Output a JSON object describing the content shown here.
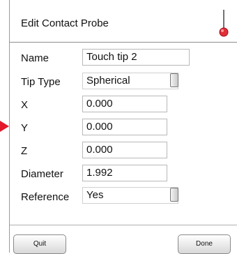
{
  "dialog": {
    "title": "Edit Contact Probe",
    "icon": "probe-tip-icon"
  },
  "fields": {
    "name": {
      "label": "Name",
      "value": "Touch tip 2"
    },
    "tip_type": {
      "label": "Tip Type",
      "value": "Spherical"
    },
    "x": {
      "label": "X",
      "value": "0.000"
    },
    "y": {
      "label": "Y",
      "value": "0.000"
    },
    "z": {
      "label": "Z",
      "value": "0.000"
    },
    "diameter": {
      "label": "Diameter",
      "value": "1.992"
    },
    "reference": {
      "label": "Reference",
      "value": "Yes"
    }
  },
  "buttons": {
    "quit": "Quit",
    "done": "Done"
  },
  "colors": {
    "pointer_arrow": "#e3182b",
    "probe_ball": "#e0303a"
  },
  "indicator": "pointer-arrow-icon"
}
